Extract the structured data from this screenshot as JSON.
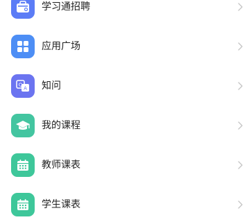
{
  "menu": {
    "items": [
      {
        "label": "学习通招聘",
        "icon": "briefcase-icon",
        "color": "#5b7cf6"
      },
      {
        "label": "应用广场",
        "icon": "apps-grid-icon",
        "color": "#4d8ef5"
      },
      {
        "label": "知问",
        "icon": "qa-icon",
        "color": "#6b74f0"
      },
      {
        "label": "我的课程",
        "icon": "graduation-cap-icon",
        "color": "#43c5a0"
      },
      {
        "label": "教师课表",
        "icon": "calendar-icon",
        "color": "#3ec79a"
      },
      {
        "label": "学生课表",
        "icon": "calendar-icon",
        "color": "#3ec79a"
      }
    ],
    "chevron_color": "#c4c4c4"
  }
}
